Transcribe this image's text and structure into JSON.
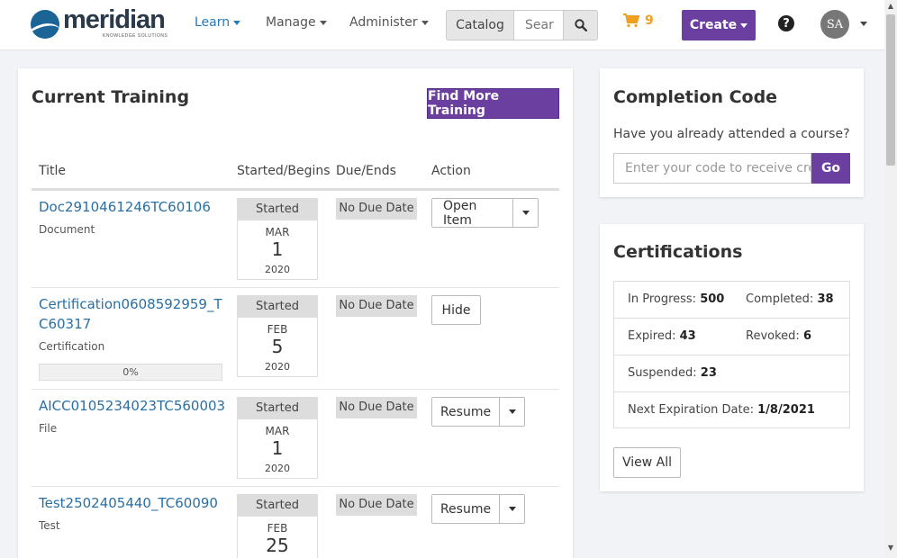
{
  "brand": {
    "name": "meridian",
    "tagline": "KNOWLEDGE SOLUTIONS"
  },
  "nav": {
    "items": [
      "Learn",
      "Manage",
      "Administer"
    ],
    "active": "Learn",
    "catalog_label": "Catalog",
    "search_placeholder": "Sear",
    "cart_count": "9",
    "create_label": "Create",
    "help_glyph": "?",
    "avatar_initials": "SA"
  },
  "current_training": {
    "title": "Current Training",
    "find_more_label": "Find More Training",
    "columns": [
      "Title",
      "Started/Begins",
      "Due/Ends",
      "Action"
    ],
    "rows": [
      {
        "title": "Doc2910461246TC60106",
        "type": "Document",
        "status": "Started",
        "month": "MAR",
        "day": "1",
        "year": "2020",
        "due": "No Due Date",
        "action": "Open Item",
        "has_dropdown": true,
        "progress": null
      },
      {
        "title": "Certification0608592959_TC60317",
        "type": "Certification",
        "status": "Started",
        "month": "FEB",
        "day": "5",
        "year": "2020",
        "due": "No Due Date",
        "action": "Hide",
        "has_dropdown": false,
        "progress": "0%"
      },
      {
        "title": "AICC0105234023TC560003",
        "type": "File",
        "status": "Started",
        "month": "MAR",
        "day": "1",
        "year": "2020",
        "due": "No Due Date",
        "action": "Resume",
        "has_dropdown": true,
        "progress": null
      },
      {
        "title": "Test2502405440_TC60090",
        "type": "Test",
        "status": "Started",
        "month": "FEB",
        "day": "25",
        "year": "",
        "due": "No Due Date",
        "action": "Resume",
        "has_dropdown": true,
        "progress": null
      }
    ]
  },
  "completion_code": {
    "title": "Completion Code",
    "prompt": "Have you already attended a course?",
    "placeholder": "Enter your code to receive cred",
    "go_label": "Go"
  },
  "certifications": {
    "title": "Certifications",
    "in_progress_label": "In Progress:",
    "in_progress": "500",
    "completed_label": "Completed:",
    "completed": "38",
    "expired_label": "Expired:",
    "expired": "43",
    "revoked_label": "Revoked:",
    "revoked": "6",
    "suspended_label": "Suspended:",
    "suspended": "23",
    "next_expiration_label": "Next Expiration Date:",
    "next_expiration": "1/8/2021",
    "view_all_label": "View All"
  },
  "colors": {
    "accent": "#6b3fa0",
    "link": "#2a6fa3",
    "cart": "#f0a020",
    "nav_active": "#2a7ab8"
  }
}
